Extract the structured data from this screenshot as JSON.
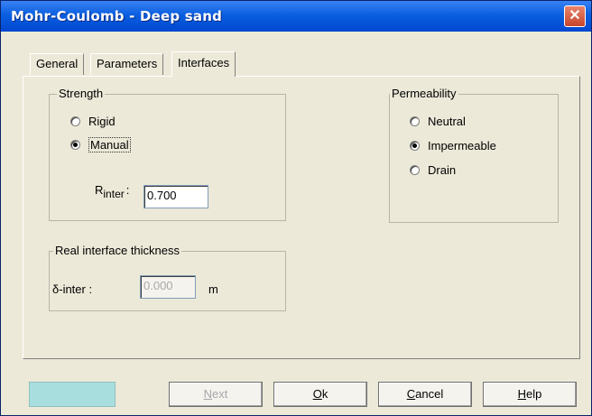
{
  "window": {
    "title": "Mohr-Coulomb - Deep sand",
    "close_label": "✕"
  },
  "tabs": [
    {
      "label": "General"
    },
    {
      "label": "Parameters"
    },
    {
      "label": "Interfaces",
      "active": true
    }
  ],
  "strength": {
    "title": "Strength",
    "options": [
      {
        "label": "Rigid",
        "selected": false
      },
      {
        "label": "Manual",
        "selected": true
      }
    ],
    "rinter_label": "R",
    "rinter_sub": "inter",
    "rinter_colon": ":",
    "rinter_value": "0.700"
  },
  "permeability": {
    "title": "Permeability",
    "options": [
      {
        "label": "Neutral",
        "selected": false
      },
      {
        "label": "Impermeable",
        "selected": true
      },
      {
        "label": "Drain",
        "selected": false
      }
    ]
  },
  "thickness": {
    "title": "Real interface thickness",
    "delta_label": "δ-inter :",
    "value": "0.000",
    "unit": "m"
  },
  "buttons": {
    "next_prefix": "",
    "next_mnemonic": "N",
    "next_rest": "ext",
    "ok_mnemonic": "O",
    "ok_rest": "k",
    "cancel_mnemonic": "C",
    "cancel_rest": "ancel",
    "help_mnemonic": "H",
    "help_rest": "elp"
  },
  "colors": {
    "title_bar": "#0a5fe0",
    "dialog_bg": "#ece9d8",
    "swatch": "#a8dede"
  }
}
